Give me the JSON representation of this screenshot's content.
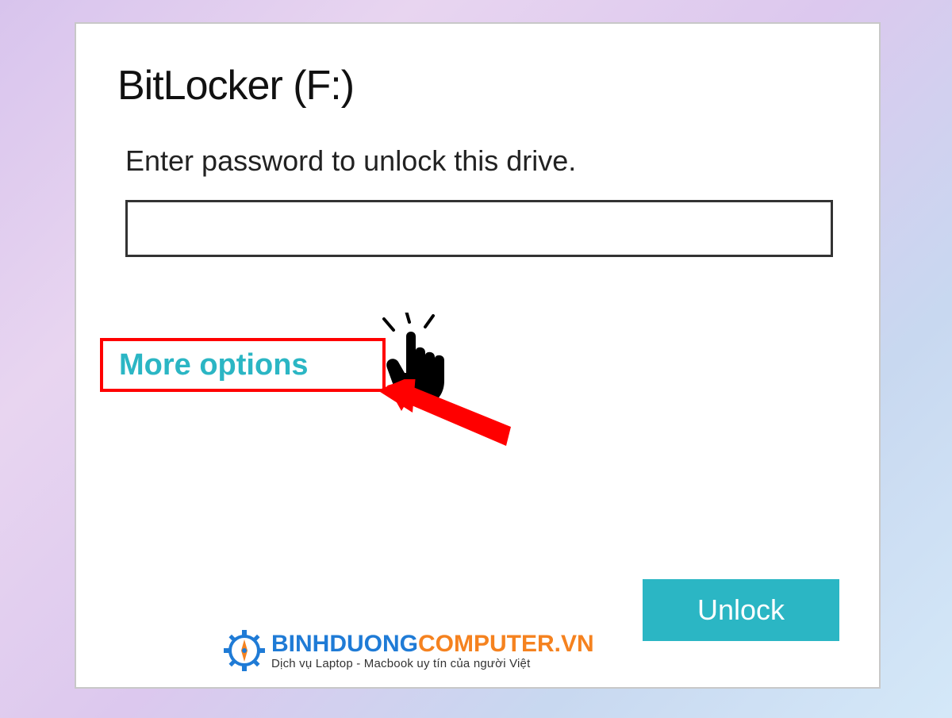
{
  "dialog": {
    "title": "BitLocker (F:)",
    "instruction": "Enter password to unlock this drive.",
    "password_value": "",
    "more_options_label": "More options",
    "unlock_label": "Unlock"
  },
  "watermark": {
    "brand_part1": "BINHDUONG",
    "brand_part2": "COMPUTER.VN",
    "tagline": "Dịch vụ Laptop - Macbook uy tín của người Việt"
  }
}
